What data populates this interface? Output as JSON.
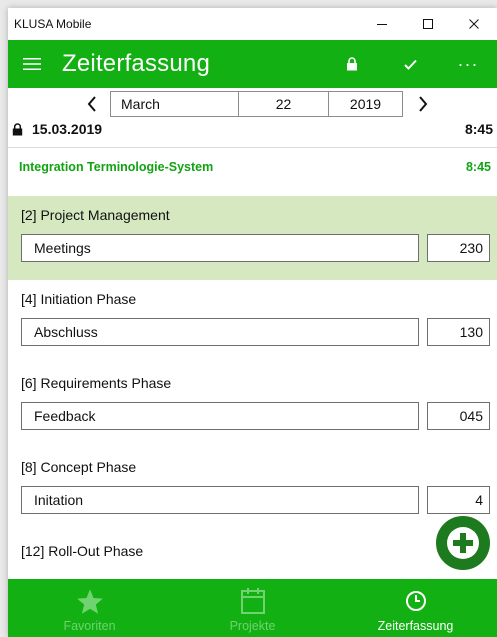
{
  "window": {
    "title": "KLUSA Mobile"
  },
  "appbar": {
    "title": "Zeiterfassung",
    "menu_icon": "hamburger-icon",
    "lock_icon": "lock-icon",
    "check_icon": "check-icon",
    "more_icon": "more-icon",
    "more_label": "···"
  },
  "date_picker": {
    "month": "March",
    "day": "22",
    "year": "2019",
    "prev_label": "‹",
    "next_label": "›"
  },
  "summary": {
    "date": "15.03.2019",
    "total": "8:45"
  },
  "project": {
    "name": "Integration Terminologie-System",
    "hours": "8:45"
  },
  "entries": [
    {
      "phase": "[2] Project Management",
      "task": "Meetings",
      "value": "230",
      "selected": true
    },
    {
      "phase": "[4] Initiation Phase",
      "task": "Abschluss",
      "value": "130",
      "selected": false
    },
    {
      "phase": "[6] Requirements Phase",
      "task": "Feedback",
      "value": "045",
      "selected": false
    },
    {
      "phase": "[8] Concept Phase",
      "task": "Initation",
      "value": "4",
      "selected": false
    },
    {
      "phase": "[12] Roll-Out Phase",
      "task": "",
      "value": "",
      "selected": false
    }
  ],
  "fab": {
    "icon": "plus-icon"
  },
  "bottomnav": {
    "items": [
      {
        "label": "Favoriten",
        "icon": "star-icon",
        "active": false
      },
      {
        "label": "Projekte",
        "icon": "calendar-icon",
        "active": false
      },
      {
        "label": "Zeiterfassung",
        "icon": "clock-icon",
        "active": true
      }
    ]
  },
  "colors": {
    "brand_green": "#12b012",
    "selected_row": "#d5e8bf",
    "project_green": "#12a312",
    "fab_green": "#1e7a1e",
    "inactive_nav": "#6fd36f"
  }
}
